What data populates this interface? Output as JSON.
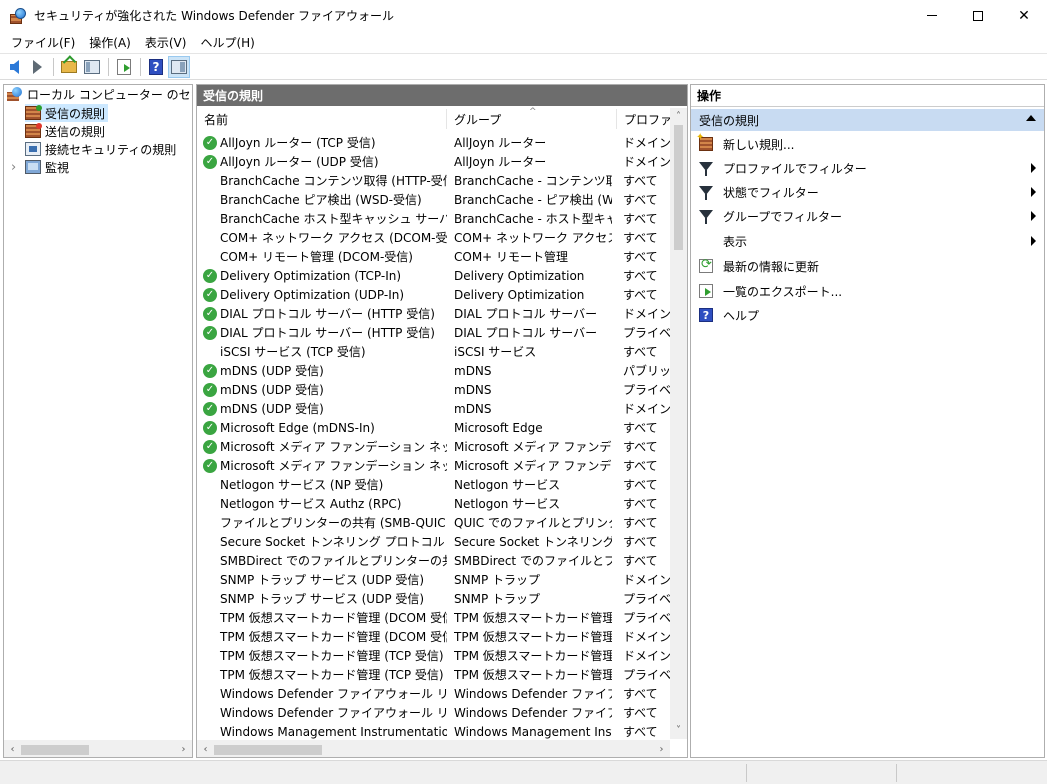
{
  "window": {
    "title": "セキュリティが強化された Windows Defender ファイアウォール",
    "controls": {
      "minimize": "—",
      "maximize": "☐",
      "close": "✕"
    }
  },
  "menubar": [
    {
      "label": "ファイル(F)"
    },
    {
      "label": "操作(A)"
    },
    {
      "label": "表示(V)"
    },
    {
      "label": "ヘルプ(H)"
    }
  ],
  "toolbar": {
    "icons": [
      "back-arrow-icon",
      "forward-arrow-icon",
      "up-folder-icon",
      "show-hide-console-tree-icon",
      "export-list-icon",
      "help-icon",
      "show-hide-action-pane-icon"
    ],
    "help_glyph": "?"
  },
  "tree": {
    "root": "ローカル コンピューター のセキュリティ",
    "items": [
      {
        "label": "受信の規則",
        "selected": true
      },
      {
        "label": "送信の規則",
        "selected": false
      },
      {
        "label": "接続セキュリティの規則",
        "selected": false
      },
      {
        "label": "監視",
        "selected": false
      }
    ],
    "expander": "›"
  },
  "center": {
    "title": "受信の規則",
    "columns": {
      "name": "名前",
      "group": "グループ",
      "profile": "プロファイ..."
    },
    "sort_indicator": "^",
    "rows": [
      {
        "enabled": true,
        "name": "AllJoyn ルーター (TCP 受信)",
        "group": "AllJoyn ルーター",
        "profile": "ドメイン, プ"
      },
      {
        "enabled": true,
        "name": "AllJoyn ルーター (UDP 受信)",
        "group": "AllJoyn ルーター",
        "profile": "ドメイン, プ"
      },
      {
        "enabled": false,
        "name": "BranchCache コンテンツ取得 (HTTP-受信)",
        "group": "BranchCache - コンテンツ取得...",
        "profile": "すべて"
      },
      {
        "enabled": false,
        "name": "BranchCache ピア検出 (WSD-受信)",
        "group": "BranchCache - ピア検出 (WS...",
        "profile": "すべて"
      },
      {
        "enabled": false,
        "name": "BranchCache ホスト型キャッシュ サーバー (HT...",
        "group": "BranchCache - ホスト型キャッ...",
        "profile": "すべて"
      },
      {
        "enabled": false,
        "name": "COM+ ネットワーク アクセス (DCOM-受信)",
        "group": "COM+ ネットワーク アクセス",
        "profile": "すべて"
      },
      {
        "enabled": false,
        "name": "COM+ リモート管理 (DCOM-受信)",
        "group": "COM+ リモート管理",
        "profile": "すべて"
      },
      {
        "enabled": true,
        "name": "Delivery Optimization (TCP-In)",
        "group": "Delivery Optimization",
        "profile": "すべて"
      },
      {
        "enabled": true,
        "name": "Delivery Optimization (UDP-In)",
        "group": "Delivery Optimization",
        "profile": "すべて"
      },
      {
        "enabled": true,
        "name": "DIAL プロトコル サーバー (HTTP 受信)",
        "group": "DIAL プロトコル サーバー",
        "profile": "ドメイン"
      },
      {
        "enabled": true,
        "name": "DIAL プロトコル サーバー (HTTP 受信)",
        "group": "DIAL プロトコル サーバー",
        "profile": "プライベー"
      },
      {
        "enabled": false,
        "name": "iSCSI サービス (TCP 受信)",
        "group": "iSCSI サービス",
        "profile": "すべて"
      },
      {
        "enabled": true,
        "name": "mDNS (UDP 受信)",
        "group": "mDNS",
        "profile": "パブリック"
      },
      {
        "enabled": true,
        "name": "mDNS (UDP 受信)",
        "group": "mDNS",
        "profile": "プライベー"
      },
      {
        "enabled": true,
        "name": "mDNS (UDP 受信)",
        "group": "mDNS",
        "profile": "ドメイン"
      },
      {
        "enabled": true,
        "name": "Microsoft Edge (mDNS-In)",
        "group": "Microsoft Edge",
        "profile": "すべて"
      },
      {
        "enabled": true,
        "name": "Microsoft メディア ファンデーション ネットワーク ...",
        "group": "Microsoft メディア ファンデーショ...",
        "profile": "すべて"
      },
      {
        "enabled": true,
        "name": "Microsoft メディア ファンデーション ネットワーク ...",
        "group": "Microsoft メディア ファンデーショ...",
        "profile": "すべて"
      },
      {
        "enabled": false,
        "name": "Netlogon サービス (NP 受信)",
        "group": "Netlogon サービス",
        "profile": "すべて"
      },
      {
        "enabled": false,
        "name": "Netlogon サービス Authz (RPC)",
        "group": "Netlogon サービス",
        "profile": "すべて"
      },
      {
        "enabled": false,
        "name": "ファイルとプリンターの共有 (SMB-QUIC 受信)",
        "group": "QUIC でのファイルとプリンターの...",
        "profile": "すべて"
      },
      {
        "enabled": false,
        "name": "Secure Socket トンネリング プロトコル (SSTP ...",
        "group": "Secure Socket トンネリング プ...",
        "profile": "すべて"
      },
      {
        "enabled": false,
        "name": "SMBDirect でのファイルとプリンターの共有 (i...",
        "group": "SMBDirect でのファイルとプリン...",
        "profile": "すべて"
      },
      {
        "enabled": false,
        "name": "SNMP トラップ サービス (UDP 受信)",
        "group": "SNMP トラップ",
        "profile": "ドメイン"
      },
      {
        "enabled": false,
        "name": "SNMP トラップ サービス (UDP 受信)",
        "group": "SNMP トラップ",
        "profile": "プライベー"
      },
      {
        "enabled": false,
        "name": "TPM 仮想スマートカード管理 (DCOM 受信)",
        "group": "TPM 仮想スマートカード管理",
        "profile": "プライベー"
      },
      {
        "enabled": false,
        "name": "TPM 仮想スマートカード管理 (DCOM 受信)",
        "group": "TPM 仮想スマートカード管理",
        "profile": "ドメイン"
      },
      {
        "enabled": false,
        "name": "TPM 仮想スマートカード管理 (TCP 受信)",
        "group": "TPM 仮想スマートカード管理",
        "profile": "ドメイン"
      },
      {
        "enabled": false,
        "name": "TPM 仮想スマートカード管理 (TCP 受信)",
        "group": "TPM 仮想スマートカード管理",
        "profile": "プライベー"
      },
      {
        "enabled": false,
        "name": "Windows Defender ファイアウォール リモート...",
        "group": "Windows Defender ファイアウ...",
        "profile": "すべて"
      },
      {
        "enabled": false,
        "name": "Windows Defender ファイアウォール リモート...",
        "group": "Windows Defender ファイアウ...",
        "profile": "すべて"
      },
      {
        "enabled": false,
        "name": "Windows Management Instrumentation (...",
        "group": "Windows Management Instr...",
        "profile": "すべて"
      }
    ],
    "check_glyph": "✓"
  },
  "actions": {
    "title": "操作",
    "section": "受信の規則",
    "items": [
      {
        "label": "新しい規則...",
        "icon": "new-rule-icon",
        "submenu": false
      },
      {
        "label": "プロファイルでフィルター",
        "icon": "filter-icon",
        "submenu": true
      },
      {
        "label": "状態でフィルター",
        "icon": "filter-icon",
        "submenu": true
      },
      {
        "label": "グループでフィルター",
        "icon": "filter-icon",
        "submenu": true
      },
      {
        "label": "表示",
        "icon": "",
        "submenu": true
      },
      {
        "label": "最新の情報に更新",
        "icon": "refresh-icon",
        "submenu": false
      },
      {
        "label": "一覧のエクスポート...",
        "icon": "export-list-icon",
        "submenu": false
      },
      {
        "label": "ヘルプ",
        "icon": "help-icon",
        "submenu": false
      }
    ],
    "help_glyph": "?"
  },
  "scroll": {
    "left": "‹",
    "right": "›",
    "up": "˄",
    "down": "˅"
  }
}
